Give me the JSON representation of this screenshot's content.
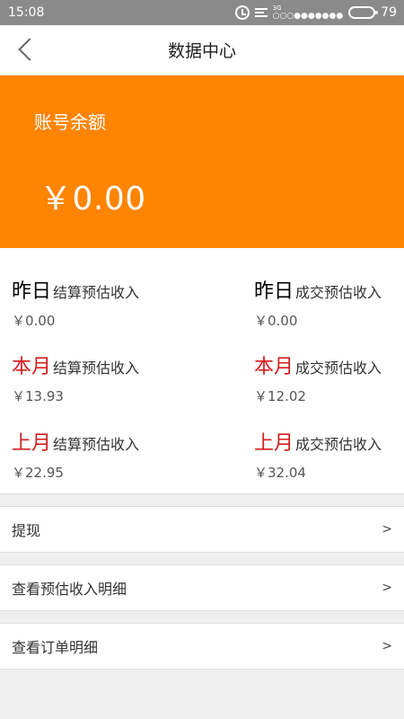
{
  "status_bar": {
    "time": "15:08",
    "network": "3G",
    "signal_dots": "○○○●●●●●●●",
    "battery": "79"
  },
  "nav": {
    "title": "数据中心"
  },
  "balance": {
    "label": "账号余额",
    "amount": "￥0.00"
  },
  "stats": [
    {
      "period": "昨日",
      "metric": "结算预估收入",
      "value": "￥0.00"
    },
    {
      "period": "昨日",
      "metric": "成交预估收入",
      "value": "￥0.00"
    },
    {
      "period": "本月",
      "metric": "结算预估收入",
      "value": "￥13.93"
    },
    {
      "period": "本月",
      "metric": "成交预估收入",
      "value": "￥12.02"
    },
    {
      "period": "上月",
      "metric": "结算预估收入",
      "value": "￥22.95"
    },
    {
      "period": "上月",
      "metric": "成交预估收入",
      "value": "￥32.04"
    }
  ],
  "menu": [
    {
      "label": "提现",
      "arrow": ">"
    },
    {
      "label": "查看预估收入明细",
      "arrow": ">"
    },
    {
      "label": "查看订单明细",
      "arrow": ">"
    }
  ],
  "colors": {
    "accent_orange": "#ff8400",
    "highlight_red": "#d31c1c",
    "status_bar_gray": "#8a8a8a"
  }
}
